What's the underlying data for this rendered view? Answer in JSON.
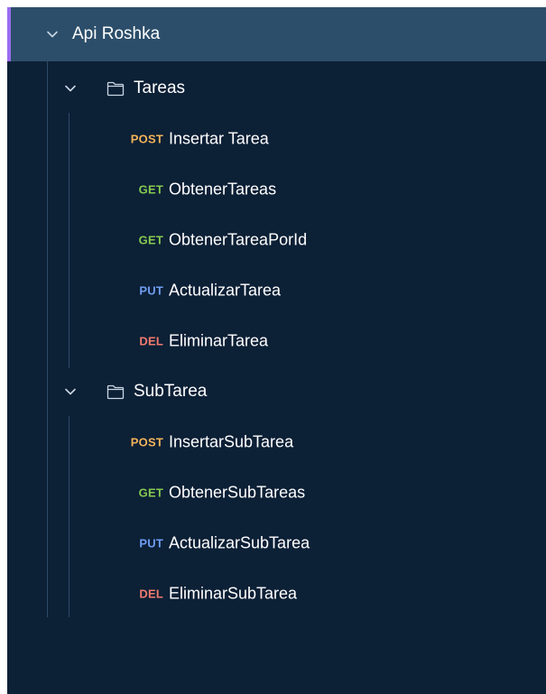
{
  "collection": {
    "name": "Api Roshka",
    "expanded": true,
    "accent_color": "#9b6cf0",
    "icon": "chevron-down-icon"
  },
  "folders": [
    {
      "name": "Tareas",
      "expanded": true,
      "icon": "folder-icon",
      "requests": [
        {
          "method": "POST",
          "name": "Insertar Tarea"
        },
        {
          "method": "GET",
          "name": "ObtenerTareas"
        },
        {
          "method": "GET",
          "name": "ObtenerTareaPorId"
        },
        {
          "method": "PUT",
          "name": "ActualizarTarea"
        },
        {
          "method": "DEL",
          "name": "EliminarTarea"
        }
      ]
    },
    {
      "name": "SubTarea",
      "expanded": true,
      "icon": "folder-icon",
      "requests": [
        {
          "method": "POST",
          "name": "InsertarSubTarea"
        },
        {
          "method": "GET",
          "name": "ObtenerSubTareas"
        },
        {
          "method": "PUT",
          "name": "ActualizarSubTarea"
        },
        {
          "method": "DEL",
          "name": "EliminarSubTarea"
        }
      ]
    }
  ],
  "method_colors": {
    "POST": "#f2b35a",
    "GET": "#85c94f",
    "PUT": "#6f9df2",
    "DEL": "#ee7b6e"
  }
}
